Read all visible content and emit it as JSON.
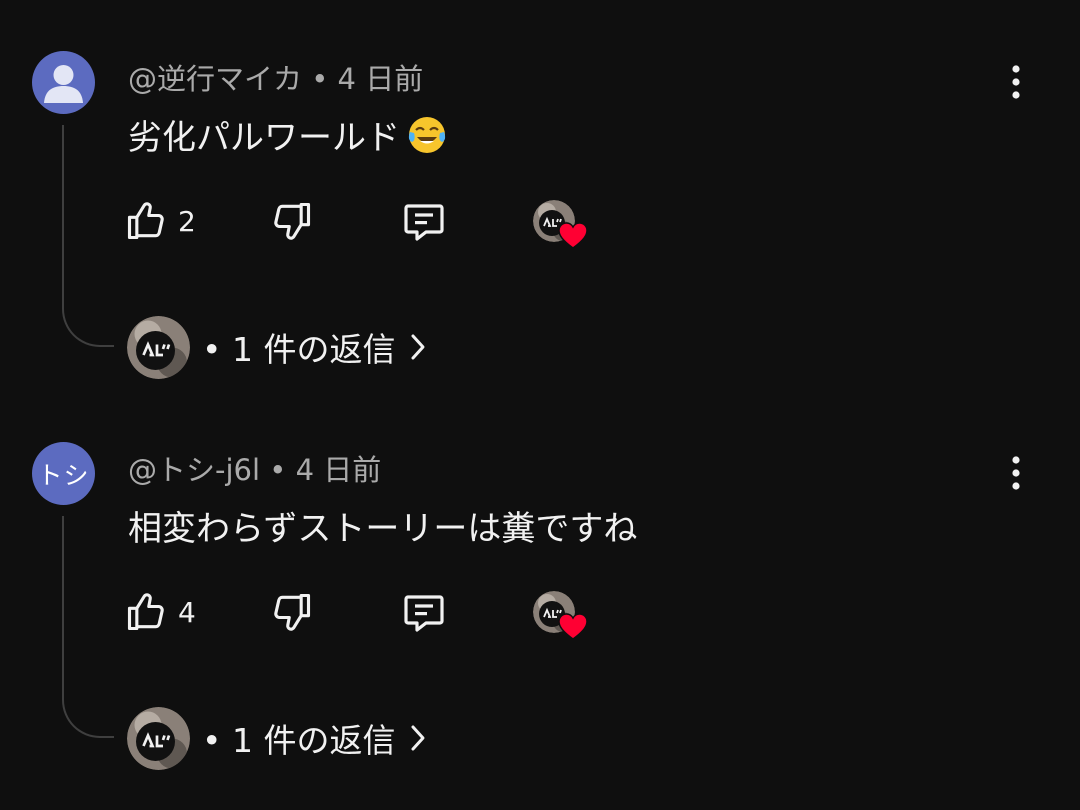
{
  "comments": [
    {
      "avatar_initials": "",
      "meta": "@逆行マイカ • 4 日前",
      "text": "劣化パルワールド",
      "emoji": "face-with-tears-of-joy-icon",
      "likes": "2",
      "replies_label": "• 1 件の返信"
    },
    {
      "avatar_initials": "トシ",
      "meta": "@トシ-j6l • 4 日前",
      "text": "相変わらずストーリーは糞ですね",
      "emoji": "",
      "likes": "4",
      "replies_label": "• 1 件の返信"
    }
  ],
  "colors": {
    "background": "#0f0f0f",
    "avatar": "#5c6bc0",
    "meta_text": "#aaaaaa",
    "heart": "#ff0033"
  },
  "icons": [
    "person-icon",
    "more-vert-icon",
    "thumb-up-icon",
    "thumb-down-icon",
    "reply-icon",
    "heart-icon",
    "chevron-right-icon"
  ]
}
